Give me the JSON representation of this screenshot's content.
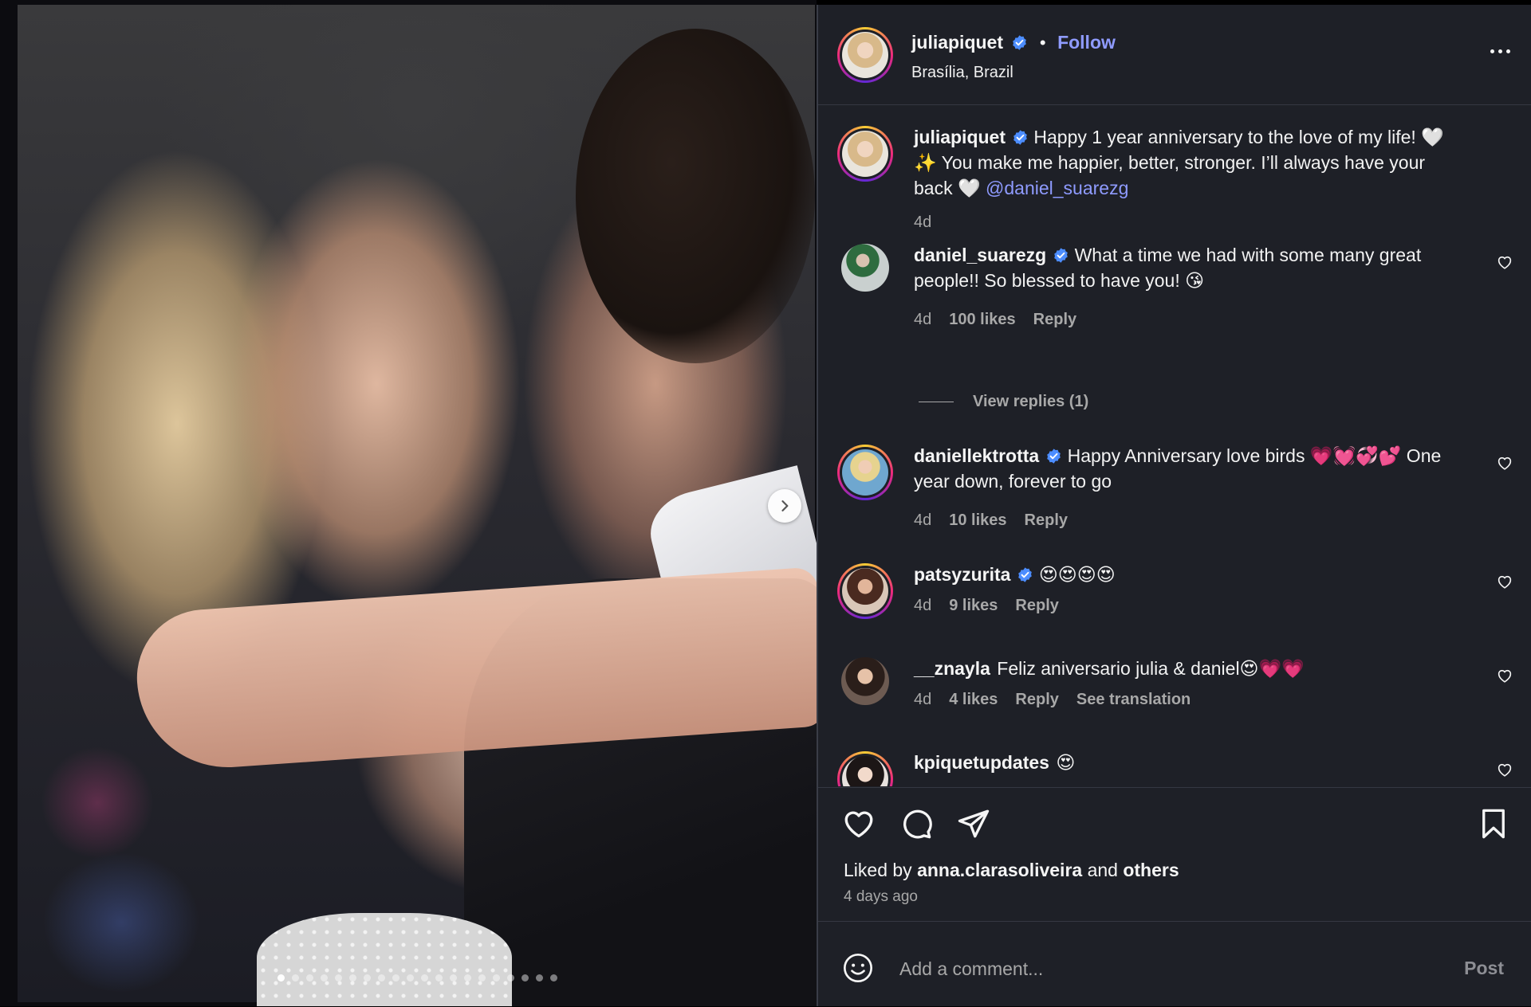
{
  "post": {
    "author": "juliapiquet",
    "follow_label": "Follow",
    "location": "Brasília, Brazil",
    "carousel": {
      "slide_count": 20,
      "active_index": 0
    }
  },
  "caption": {
    "username": "juliapiquet",
    "text_part1": "Happy 1 year anniversary to the love of my life! 🤍✨ You make me happier, better, stronger. I’ll always have your back 🤍 ",
    "mention": "@daniel_suarezg",
    "time": "4d"
  },
  "comments": [
    {
      "username": "daniel_suarezg",
      "text": "What a time we had with some many great people!! So blessed to have you! 😘",
      "time": "4d",
      "likes": "100 likes",
      "reply": "Reply",
      "view_replies": "View replies (1)"
    },
    {
      "username": "daniellektrotta",
      "text": "Happy Anniversary love birds 💗💓💞💕 One year down, forever to go",
      "time": "4d",
      "likes": "10 likes",
      "reply": "Reply"
    },
    {
      "username": "patsyzurita",
      "text": "😍😍😍😍",
      "time": "4d",
      "likes": "9 likes",
      "reply": "Reply"
    },
    {
      "username": "__znayla",
      "text": "Feliz aniversario julia & daniel😍💗💗",
      "time": "4d",
      "likes": "4 likes",
      "reply": "Reply",
      "translate": "See translation"
    },
    {
      "username": "kpiquetupdates",
      "text": "😍"
    }
  ],
  "footer": {
    "liked_by_prefix": "Liked by ",
    "liked_by_user": "anna.clarasoliveira",
    "liked_by_and": " and ",
    "liked_by_others": "others",
    "ago": "4 days ago",
    "comment_placeholder": "Add a comment...",
    "post_label": "Post"
  },
  "icons": {
    "verified": "verified-badge-icon",
    "like": "heart-icon",
    "comment": "comment-icon",
    "share": "paper-plane-icon",
    "save": "bookmark-icon",
    "emoji": "smiley-icon",
    "next": "chevron-right-icon",
    "more": "more-options-icon"
  },
  "colors": {
    "panel_bg": "#1e2027",
    "link": "#8f9bff",
    "muted": "#a8a8a8",
    "verified": "#4c8dff"
  }
}
